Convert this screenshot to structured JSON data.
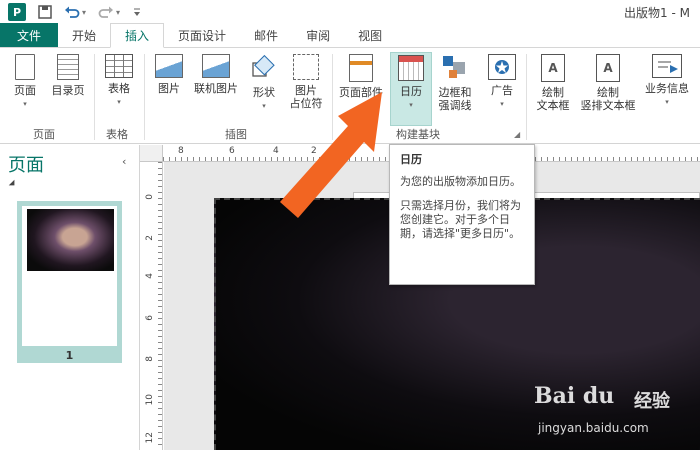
{
  "window": {
    "title": "出版物1 - M",
    "app_logo": "P",
    "quick_access": [
      "save-icon",
      "undo-icon",
      "redo-icon",
      "customize-icon"
    ]
  },
  "tabs": [
    "文件",
    "开始",
    "插入",
    "页面设计",
    "邮件",
    "审阅",
    "视图"
  ],
  "active_tab": "插入",
  "ribbon": {
    "groups": {
      "pages": "页面",
      "tables": "表格",
      "illustrations": "插图",
      "building_blocks": "构建基块"
    },
    "buttons": {
      "page": "页面",
      "toc": "目录页",
      "table": "表格",
      "picture": "图片",
      "online_picture": "联机图片",
      "shapes": "形状",
      "placeholder_l1": "图片",
      "placeholder_l2": "占位符",
      "page_parts": "页面部件",
      "calendar": "日历",
      "borders_l1": "边框和",
      "borders_l2": "强调线",
      "ad": "广告",
      "textbox_l1": "绘制",
      "textbox_l2": "文本框",
      "vtextbox_l1": "绘制",
      "vtextbox_l2": "竖排文本框",
      "business_info": "业务信息"
    },
    "drop_glyph": "▾"
  },
  "tooltip": {
    "title": "日历",
    "desc": "为您的出版物添加日历。",
    "detail": "只需选择月份，我们将为您创建它。对于多个日期，请选择\"更多日历\"。"
  },
  "pane": {
    "title": "页面",
    "close_glyph": "‹",
    "page_number": "1"
  },
  "rulers": {
    "h_numbers": [
      "8",
      "6",
      "4",
      "2"
    ],
    "v_numbers": [
      "0",
      "2",
      "4",
      "6",
      "8",
      "10",
      "12"
    ]
  },
  "watermark": {
    "logo": "Bai du",
    "exp": "经验",
    "url": "jingyan.baidu.com"
  },
  "colors": {
    "accent": "#077568",
    "highlight": "#c9e8e4",
    "arrow": "#f26522"
  }
}
